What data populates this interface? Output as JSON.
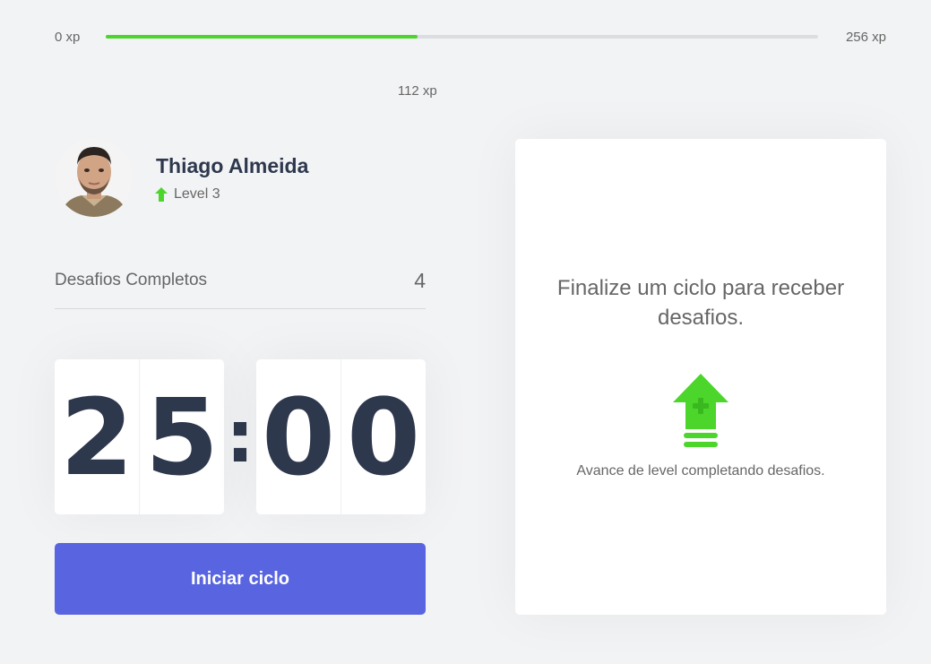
{
  "experience": {
    "min_label": "0 xp",
    "max_label": "256 xp",
    "current_label": "112 xp",
    "progress_percent": 43.75,
    "bar_color": "#4cd62b"
  },
  "profile": {
    "name": "Thiago Almeida",
    "level_label": "Level 3",
    "level_icon": "level-up-arrow-icon"
  },
  "challenges": {
    "completed_label": "Desafios Completos",
    "completed_count": "4"
  },
  "countdown": {
    "minute_left": "2",
    "minute_right": "5",
    "separator": ":",
    "second_left": "0",
    "second_right": "0"
  },
  "start_button": {
    "label": "Iniciar ciclo",
    "color": "#5965e0"
  },
  "challenge_box": {
    "title": "Finalize um ciclo para receber desafios.",
    "icon": "level-up-icon",
    "hint": "Avance de level completando desafios."
  },
  "colors": {
    "background": "#f2f3f5",
    "text": "#666666",
    "title": "#2e384d",
    "green": "#4cd62b",
    "blue": "#5965e0"
  }
}
